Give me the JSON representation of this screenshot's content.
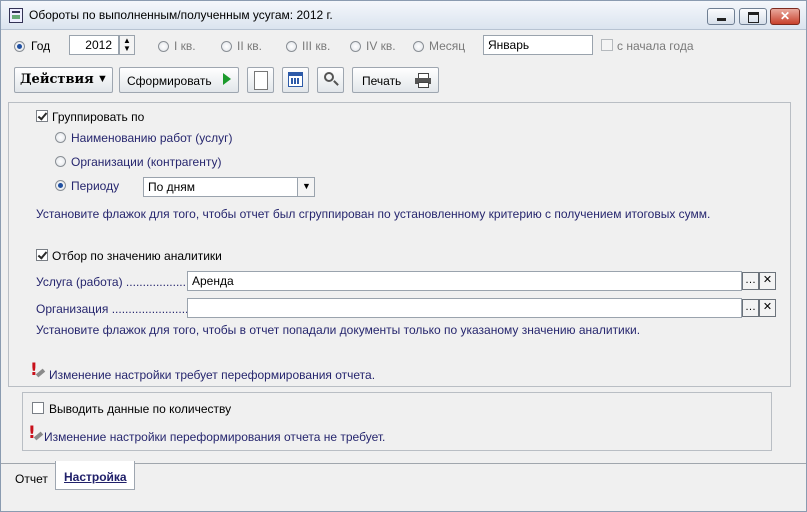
{
  "window": {
    "title": "Обороты по выполненным/полученным усугам: 2012 г."
  },
  "period": {
    "options": [
      "Год",
      "I кв.",
      "II кв.",
      "III кв.",
      "IV кв.",
      "Месяц"
    ],
    "selected": "Год",
    "year": "2012",
    "month": "Январь",
    "from_start_label": "с начала года"
  },
  "toolbar": {
    "actions_label": "Действия",
    "generate_label": "Сформировать",
    "print_label": "Печать"
  },
  "group": {
    "checkbox_label": "Группировать по",
    "options": [
      "Наименованию работ (услуг)",
      "Организации (контрагенту)",
      "Периоду"
    ],
    "selected": "Периоду",
    "period_value": "По дням",
    "hint": "Установите флажок для того, чтобы отчет был сгруппирован по установленному критерию с получением итоговых сумм."
  },
  "filter": {
    "checkbox_label": "Отбор по значению аналитики",
    "service_label": "Услуга (работа) ...................",
    "service_value": "Аренда",
    "org_label": "Организация .......................",
    "org_value": "",
    "hint": "Установите флажок для того, чтобы в отчет попадали документы только по  указаному значению аналитики."
  },
  "notice1": "Изменение настройки требует переформирования отчета.",
  "quantity": {
    "checkbox_label": "Выводить данные по количеству",
    "notice": "Изменение настройки переформирования отчета не требует."
  },
  "tabs": [
    "Отчет",
    "Настройка"
  ],
  "active_tab": "Настройка",
  "colors": {
    "hint_text": "#26266e",
    "warn_red": "#c8101a",
    "accent_blue": "#1f4fa0"
  }
}
